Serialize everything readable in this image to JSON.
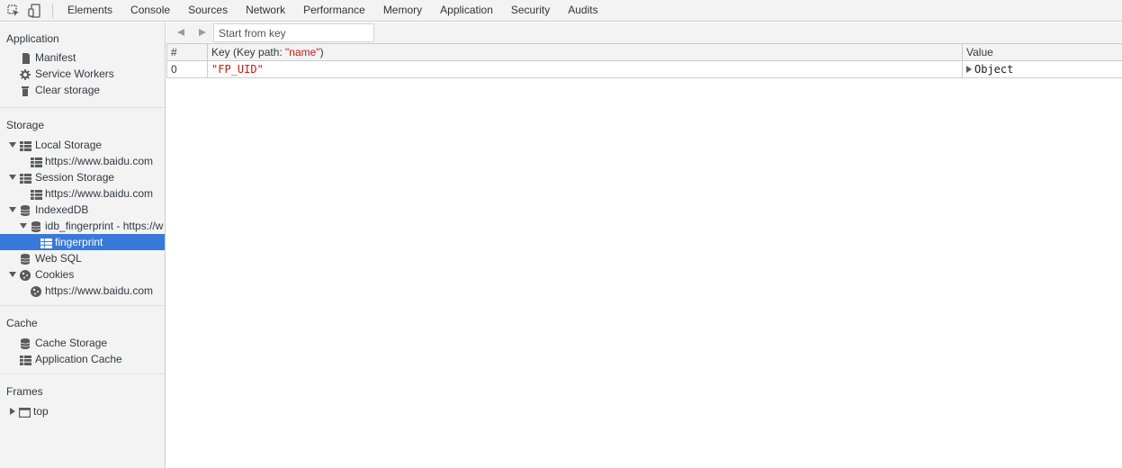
{
  "toolbar": {
    "tabs": [
      "Elements",
      "Console",
      "Sources",
      "Network",
      "Performance",
      "Memory",
      "Application",
      "Security",
      "Audits"
    ],
    "active_tab": "Application"
  },
  "sidebar": {
    "application": {
      "title": "Application",
      "items": [
        "Manifest",
        "Service Workers",
        "Clear storage"
      ]
    },
    "storage": {
      "title": "Storage",
      "local_storage": "Local Storage",
      "local_storage_origin": "https://www.baidu.com",
      "session_storage": "Session Storage",
      "session_storage_origin": "https://www.baidu.com",
      "indexeddb": "IndexedDB",
      "idb_database": "idb_fingerprint - https://w",
      "idb_store": "fingerprint",
      "web_sql": "Web SQL",
      "cookies": "Cookies",
      "cookies_origin": "https://www.baidu.com"
    },
    "cache": {
      "title": "Cache",
      "items": [
        "Cache Storage",
        "Application Cache"
      ]
    },
    "frames": {
      "title": "Frames",
      "top": "top"
    }
  },
  "main": {
    "search": {
      "placeholder": "Start from key"
    },
    "columns": {
      "index": "#",
      "key_prefix": "Key (Key path: ",
      "key_path": "\"name\"",
      "key_suffix": ")",
      "value": "Value"
    },
    "rows": [
      {
        "index": "0",
        "key": "\"FP_UID\"",
        "value": "Object"
      }
    ]
  },
  "colors": {
    "selection": "#3879d9",
    "string_value": "#c41a16",
    "panel_bg": "#f3f3f3",
    "border": "#cccccc"
  }
}
